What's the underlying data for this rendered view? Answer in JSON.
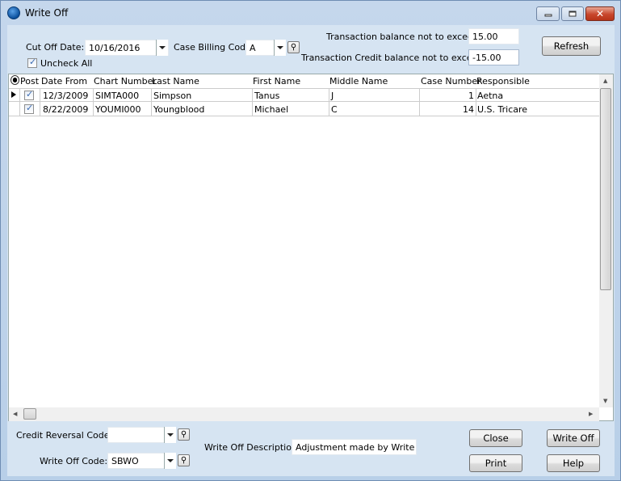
{
  "window": {
    "title": "Write Off",
    "min": "minimize",
    "max": "maximize",
    "close": "✕"
  },
  "filters": {
    "cut_off_label": "Cut Off Date:",
    "cut_off_value": "10/16/2016",
    "case_billing_label": "Case Billing Code:",
    "case_billing_value": "A",
    "uncheck_all_label": "Uncheck All",
    "txn_balance_label": "Transaction balance not to exceed:",
    "txn_balance_value": "15.00",
    "txn_credit_label": "Transaction Credit balance not to exceed:",
    "txn_credit_value": "-15.00",
    "refresh_label": "Refresh"
  },
  "grid": {
    "columns": [
      "Post",
      "Date From",
      "Chart Number",
      "Last Name",
      "First Name",
      "Middle Name",
      "Case Number",
      "Responsible"
    ],
    "rows": [
      {
        "post": true,
        "date_from": "12/3/2009",
        "chart": "SIMTA000",
        "last": "Simpson",
        "first": "Tanus",
        "middle": "J",
        "case": "1",
        "responsible": "Aetna"
      },
      {
        "post": true,
        "date_from": "8/22/2009",
        "chart": "YOUMI000",
        "last": "Youngblood",
        "first": "Michael",
        "middle": "C",
        "case": "14",
        "responsible": "U.S. Tricare"
      }
    ]
  },
  "footer": {
    "credit_reversal_label": "Credit Reversal Code:",
    "credit_reversal_value": "",
    "write_off_code_label": "Write Off Code:",
    "write_off_code_value": "SBWO",
    "description_label": "Write Off Description:",
    "description_value": "Adjustment made by Write Off",
    "close_label": "Close",
    "write_off_label": "Write Off",
    "print_label": "Print",
    "help_label": "Help"
  }
}
